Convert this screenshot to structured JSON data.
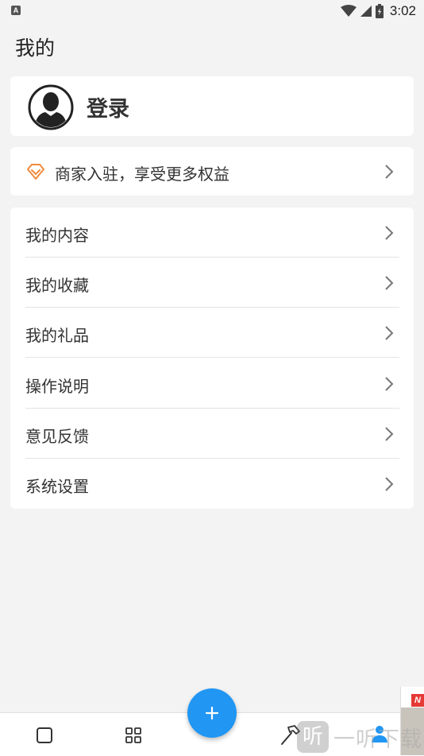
{
  "status_bar": {
    "app_badge": "A",
    "time": "3:02"
  },
  "header": {
    "title": "我的"
  },
  "login": {
    "label": "登录"
  },
  "merchant": {
    "label": "商家入驻，享受更多权益"
  },
  "menu": {
    "items": [
      {
        "label": "我的内容"
      },
      {
        "label": "我的收藏"
      },
      {
        "label": "我的礼品"
      },
      {
        "label": "操作说明"
      },
      {
        "label": "意见反馈"
      },
      {
        "label": "系统设置"
      }
    ]
  },
  "bottom_nav": {
    "icons": [
      "square-icon",
      "grid-icon",
      "add-icon",
      "hammer-icon",
      "person-icon"
    ]
  },
  "overlay": {
    "ad_badge": "N",
    "watermark_logo": "听",
    "watermark_text": "一听下载"
  },
  "colors": {
    "accent": "#2196f3",
    "merchant_icon": "#f08a3c",
    "background": "#f3f3f3"
  }
}
